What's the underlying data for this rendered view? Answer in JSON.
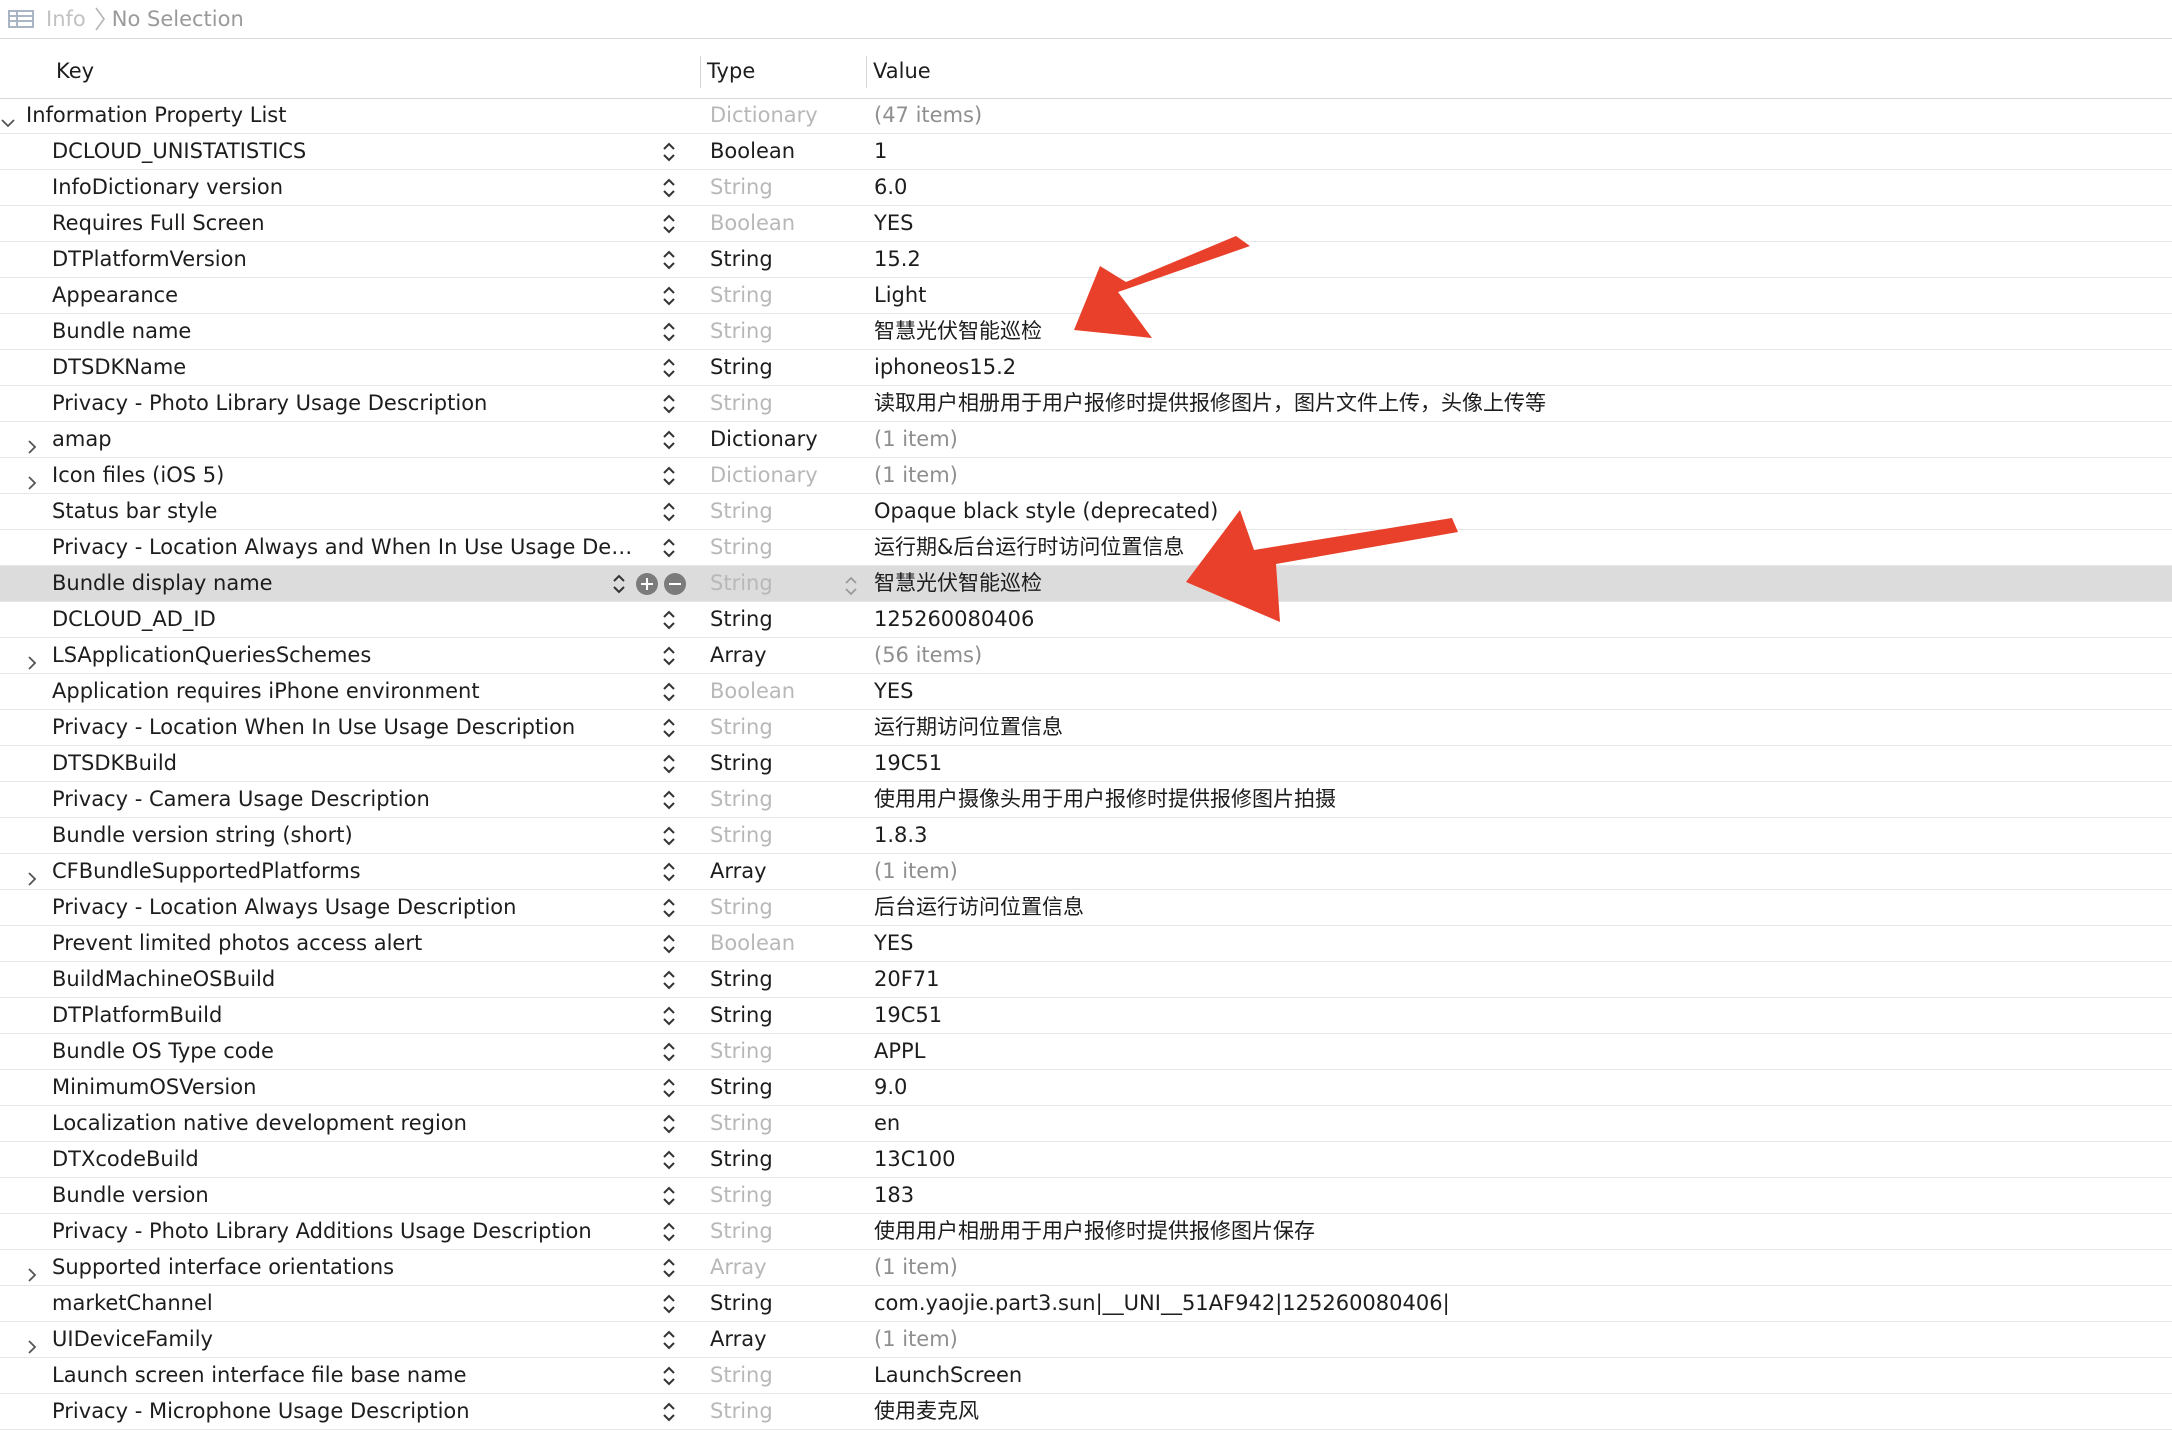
{
  "breadcrumb": {
    "icon": "property-list-icon",
    "parent": "Info",
    "current": "No Selection"
  },
  "columns": {
    "key": "Key",
    "type": "Type",
    "value": "Value"
  },
  "rows": [
    {
      "key": "Information Property List",
      "type": "Dictionary",
      "value": "(47 items)",
      "type_dim": true,
      "value_dim": true,
      "disclosure": "expanded",
      "root": true
    },
    {
      "key": "DCLOUD_UNISTATISTICS",
      "type": "Boolean",
      "value": "1",
      "type_dim": false,
      "value_dim": false,
      "disclosure": "none"
    },
    {
      "key": "InfoDictionary version",
      "type": "String",
      "value": "6.0",
      "type_dim": true,
      "value_dim": false,
      "disclosure": "none"
    },
    {
      "key": "Requires Full Screen",
      "type": "Boolean",
      "value": "YES",
      "type_dim": true,
      "value_dim": false,
      "disclosure": "none"
    },
    {
      "key": "DTPlatformVersion",
      "type": "String",
      "value": "15.2",
      "type_dim": false,
      "value_dim": false,
      "disclosure": "none"
    },
    {
      "key": "Appearance",
      "type": "String",
      "value": "Light",
      "type_dim": true,
      "value_dim": false,
      "disclosure": "none"
    },
    {
      "key": "Bundle name",
      "type": "String",
      "value": "智慧光伏智能巡检",
      "type_dim": true,
      "value_dim": false,
      "disclosure": "none"
    },
    {
      "key": "DTSDKName",
      "type": "String",
      "value": "iphoneos15.2",
      "type_dim": false,
      "value_dim": false,
      "disclosure": "none"
    },
    {
      "key": "Privacy - Photo Library Usage Description",
      "type": "String",
      "value": "读取用户相册用于用户报修时提供报修图片，图片文件上传，头像上传等",
      "type_dim": true,
      "value_dim": false,
      "disclosure": "none"
    },
    {
      "key": "amap",
      "type": "Dictionary",
      "value": "(1 item)",
      "type_dim": false,
      "value_dim": true,
      "disclosure": "collapsed"
    },
    {
      "key": "Icon files (iOS 5)",
      "type": "Dictionary",
      "value": "(1 item)",
      "type_dim": true,
      "value_dim": true,
      "disclosure": "collapsed"
    },
    {
      "key": "Status bar style",
      "type": "String",
      "value": "Opaque black style (deprecated)",
      "type_dim": true,
      "value_dim": false,
      "disclosure": "none"
    },
    {
      "key": "Privacy - Location Always and When In Use Usage Des...",
      "type": "String",
      "value": "运行期&后台运行时访问位置信息",
      "type_dim": true,
      "value_dim": false,
      "disclosure": "none"
    },
    {
      "key": "Bundle display name",
      "type": "String",
      "value": "智慧光伏智能巡检",
      "type_dim": true,
      "value_dim": false,
      "disclosure": "none",
      "selected": true
    },
    {
      "key": "DCLOUD_AD_ID",
      "type": "String",
      "value": "125260080406",
      "type_dim": false,
      "value_dim": false,
      "disclosure": "none"
    },
    {
      "key": "LSApplicationQueriesSchemes",
      "type": "Array",
      "value": "(56 items)",
      "type_dim": false,
      "value_dim": true,
      "disclosure": "collapsed"
    },
    {
      "key": "Application requires iPhone environment",
      "type": "Boolean",
      "value": "YES",
      "type_dim": true,
      "value_dim": false,
      "disclosure": "none"
    },
    {
      "key": "Privacy - Location When In Use Usage Description",
      "type": "String",
      "value": "运行期访问位置信息",
      "type_dim": true,
      "value_dim": false,
      "disclosure": "none"
    },
    {
      "key": "DTSDKBuild",
      "type": "String",
      "value": "19C51",
      "type_dim": false,
      "value_dim": false,
      "disclosure": "none"
    },
    {
      "key": "Privacy - Camera Usage Description",
      "type": "String",
      "value": "使用用户摄像头用于用户报修时提供报修图片拍摄",
      "type_dim": true,
      "value_dim": false,
      "disclosure": "none"
    },
    {
      "key": "Bundle version string (short)",
      "type": "String",
      "value": "1.8.3",
      "type_dim": true,
      "value_dim": false,
      "disclosure": "none"
    },
    {
      "key": "CFBundleSupportedPlatforms",
      "type": "Array",
      "value": "(1 item)",
      "type_dim": false,
      "value_dim": true,
      "disclosure": "collapsed"
    },
    {
      "key": "Privacy - Location Always Usage Description",
      "type": "String",
      "value": "后台运行访问位置信息",
      "type_dim": true,
      "value_dim": false,
      "disclosure": "none"
    },
    {
      "key": "Prevent limited photos access alert",
      "type": "Boolean",
      "value": "YES",
      "type_dim": true,
      "value_dim": false,
      "disclosure": "none"
    },
    {
      "key": "BuildMachineOSBuild",
      "type": "String",
      "value": "20F71",
      "type_dim": false,
      "value_dim": false,
      "disclosure": "none"
    },
    {
      "key": "DTPlatformBuild",
      "type": "String",
      "value": "19C51",
      "type_dim": false,
      "value_dim": false,
      "disclosure": "none"
    },
    {
      "key": "Bundle OS Type code",
      "type": "String",
      "value": "APPL",
      "type_dim": true,
      "value_dim": false,
      "disclosure": "none"
    },
    {
      "key": "MinimumOSVersion",
      "type": "String",
      "value": "9.0",
      "type_dim": false,
      "value_dim": false,
      "disclosure": "none"
    },
    {
      "key": "Localization native development region",
      "type": "String",
      "value": "en",
      "type_dim": true,
      "value_dim": false,
      "disclosure": "none"
    },
    {
      "key": "DTXcodeBuild",
      "type": "String",
      "value": "13C100",
      "type_dim": false,
      "value_dim": false,
      "disclosure": "none"
    },
    {
      "key": "Bundle version",
      "type": "String",
      "value": "183",
      "type_dim": true,
      "value_dim": false,
      "disclosure": "none"
    },
    {
      "key": "Privacy - Photo Library Additions Usage Description",
      "type": "String",
      "value": "使用用户相册用于用户报修时提供报修图片保存",
      "type_dim": true,
      "value_dim": false,
      "disclosure": "none"
    },
    {
      "key": "Supported interface orientations",
      "type": "Array",
      "value": "(1 item)",
      "type_dim": true,
      "value_dim": true,
      "disclosure": "collapsed"
    },
    {
      "key": "marketChannel",
      "type": "String",
      "value": "com.yaojie.part3.sun|__UNI__51AF942|125260080406|",
      "type_dim": false,
      "value_dim": false,
      "disclosure": "none"
    },
    {
      "key": "UIDeviceFamily",
      "type": "Array",
      "value": "(1 item)",
      "type_dim": false,
      "value_dim": true,
      "disclosure": "collapsed"
    },
    {
      "key": "Launch screen interface file base name",
      "type": "String",
      "value": "LaunchScreen",
      "type_dim": true,
      "value_dim": false,
      "disclosure": "none"
    },
    {
      "key": "Privacy - Microphone Usage Description",
      "type": "String",
      "value": "使用麦克风",
      "type_dim": true,
      "value_dim": false,
      "disclosure": "none"
    }
  ],
  "annotations": {
    "arrow_color": "#e8402b",
    "arrows": [
      "annotation-arrow-bundle-name",
      "annotation-arrow-bundle-display-name"
    ]
  },
  "colors": {
    "selected_row": "#dcdcdc",
    "dim_text": "#b8b8b8",
    "row_divider": "#e6e6e6"
  }
}
